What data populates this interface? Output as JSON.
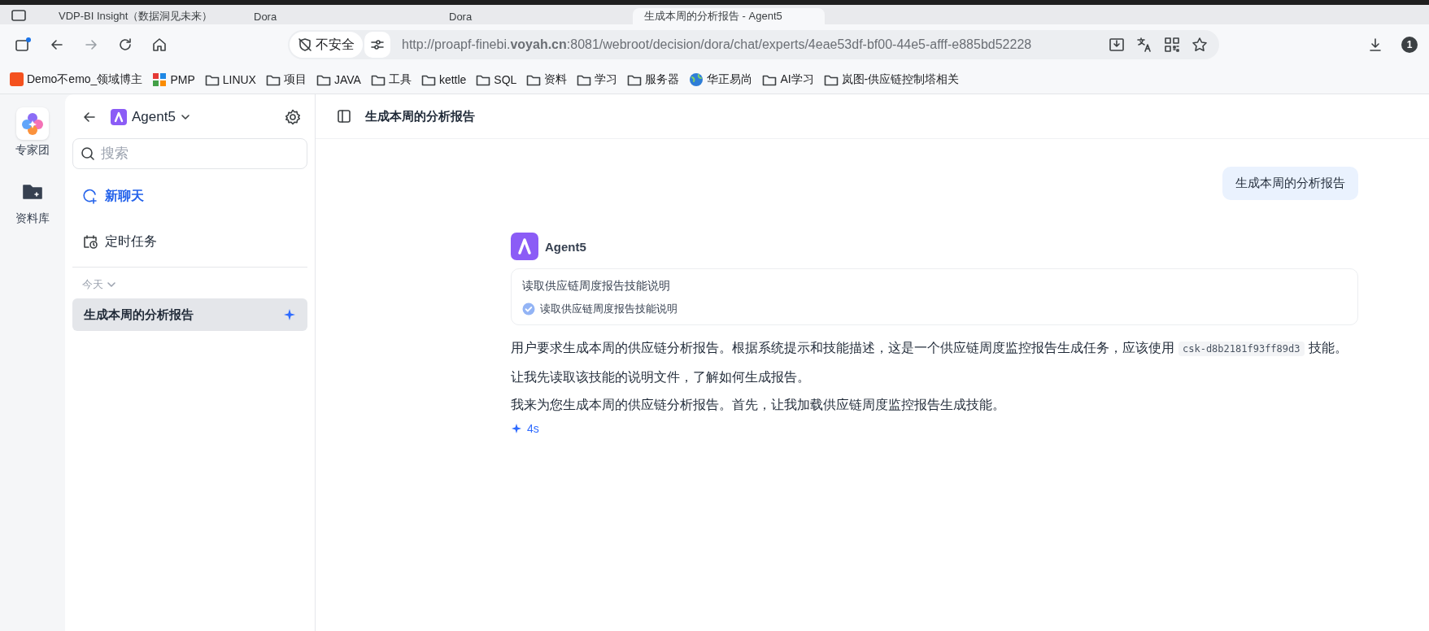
{
  "browser": {
    "tabs": [
      {
        "title": "VDP-BI Insight（数据洞见未来）",
        "selected": false
      },
      {
        "title": "Dora",
        "selected": false
      },
      {
        "title": "Dora",
        "selected": false
      },
      {
        "title": "生成本周的分析报告 - Agent5",
        "selected": true
      }
    ],
    "address_bar": {
      "security_label": "不安全",
      "url": "http://proapf-finebi.**voyah.cn**:8081/webroot/decision/dora/chat/experts/4eae53df-bf00-44e5-afff-e885bd52228"
    },
    "profile_badge": "1",
    "bookmarks": [
      {
        "kind": "c-logo",
        "label": "Demo不emo_领域博主"
      },
      {
        "kind": "pm-logo",
        "label": "PMP"
      },
      {
        "kind": "folder",
        "label": "LINUX"
      },
      {
        "kind": "folder",
        "label": "项目"
      },
      {
        "kind": "folder",
        "label": "JAVA"
      },
      {
        "kind": "folder",
        "label": "工具"
      },
      {
        "kind": "folder",
        "label": "kettle"
      },
      {
        "kind": "folder",
        "label": "SQL"
      },
      {
        "kind": "folder",
        "label": "资料"
      },
      {
        "kind": "folder",
        "label": "学习"
      },
      {
        "kind": "folder",
        "label": "服务器"
      },
      {
        "kind": "globe",
        "label": "华正易尚"
      },
      {
        "kind": "folder",
        "label": "AI学习"
      },
      {
        "kind": "folder",
        "label": "岚图-供应链控制塔相关"
      }
    ]
  },
  "rail": {
    "items": [
      {
        "kind": "team",
        "label": "专家团",
        "selected": true
      },
      {
        "kind": "library",
        "label": "资料库",
        "selected": false
      }
    ]
  },
  "sidebar": {
    "agent_name": "Agent5",
    "search": {
      "placeholder": "搜索"
    },
    "nav": [
      {
        "kind": "chat",
        "label": "新聊天",
        "selected": true
      },
      {
        "kind": "schedule",
        "label": "定时任务",
        "selected": false
      }
    ],
    "group": {
      "label": "今天",
      "expanded": true
    },
    "conversations": [
      {
        "title": "生成本周的分析报告",
        "selected": true
      }
    ]
  },
  "main": {
    "title": "生成本周的分析报告",
    "messages": [
      {
        "kind": "user",
        "text": "生成本周的分析报告"
      },
      {
        "kind": "agent",
        "name": "Agent5",
        "tool": {
          "title": "读取供应链周度报告技能说明",
          "steps": [
            {
              "label": "读取供应链周度报告技能说明",
              "done": true
            }
          ]
        },
        "paragraphs": [
          [
            {
              "kind": "text",
              "text": "用户要求生成本周的供应链分析报告。根据系统提示和技能描述，这是一个供应链周度监控报告生成任务，应该使用"
            },
            {
              "kind": "code",
              "text": "csk-d8b2181f93ff89d3"
            },
            {
              "kind": "text",
              "text": "技能。"
            }
          ],
          [
            {
              "kind": "text",
              "text": "让我先读取该技能的说明文件，了解如何生成报告。"
            }
          ],
          [
            {
              "kind": "text",
              "text": "我来为您生成本周的供应链分析报告。首先，让我加载供应链周度监控报告生成技能。"
            }
          ]
        ],
        "elapsed": "4s"
      }
    ]
  }
}
